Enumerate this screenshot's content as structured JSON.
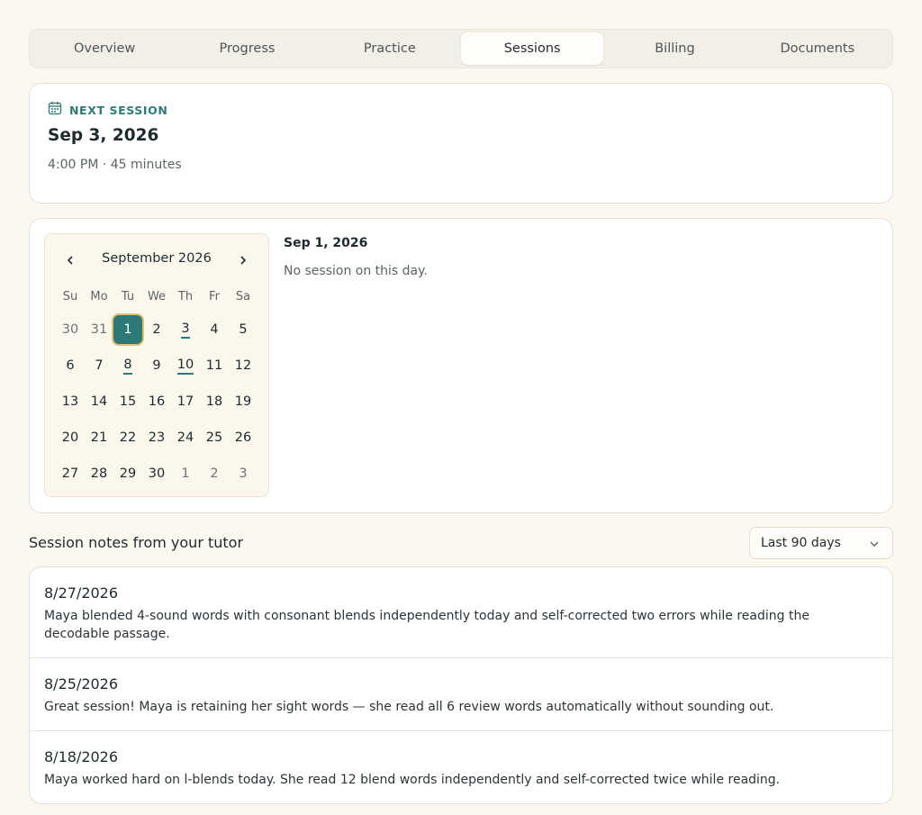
{
  "tabs": [
    "Overview",
    "Progress",
    "Practice",
    "Sessions",
    "Billing",
    "Documents"
  ],
  "active_tab": "Sessions",
  "next_session": {
    "label": "NEXT SESSION",
    "date": "Sep 3, 2026",
    "time": "4:00 PM · 45 minutes"
  },
  "calendar": {
    "month": "September 2026",
    "weekdays": [
      "Su",
      "Mo",
      "Tu",
      "We",
      "Th",
      "Fr",
      "Sa"
    ],
    "days": [
      {
        "d": "30",
        "muted": true
      },
      {
        "d": "31",
        "muted": true
      },
      {
        "d": "1",
        "selected": true
      },
      {
        "d": "2"
      },
      {
        "d": "3",
        "session": true
      },
      {
        "d": "4"
      },
      {
        "d": "5"
      },
      {
        "d": "6"
      },
      {
        "d": "7"
      },
      {
        "d": "8",
        "session": true
      },
      {
        "d": "9"
      },
      {
        "d": "10",
        "session": true
      },
      {
        "d": "11"
      },
      {
        "d": "12"
      },
      {
        "d": "13"
      },
      {
        "d": "14"
      },
      {
        "d": "15"
      },
      {
        "d": "16"
      },
      {
        "d": "17"
      },
      {
        "d": "18"
      },
      {
        "d": "19"
      },
      {
        "d": "20"
      },
      {
        "d": "21"
      },
      {
        "d": "22"
      },
      {
        "d": "23"
      },
      {
        "d": "24"
      },
      {
        "d": "25"
      },
      {
        "d": "26"
      },
      {
        "d": "27"
      },
      {
        "d": "28"
      },
      {
        "d": "29"
      },
      {
        "d": "30"
      },
      {
        "d": "1",
        "muted": true
      },
      {
        "d": "2",
        "muted": true
      },
      {
        "d": "3",
        "muted": true
      }
    ],
    "selected_date": "Sep 1, 2026",
    "empty_message": "No session on this day."
  },
  "notes": {
    "title": "Session notes from your tutor",
    "range": "Last 90 days",
    "items": [
      {
        "date": "8/27/2026",
        "text": "Maya blended 4-sound words with consonant blends independently today and self-corrected two errors while reading the decodable passage."
      },
      {
        "date": "8/25/2026",
        "text": "Great session! Maya is retaining her sight words — she read all 6 review words automatically without sounding out."
      },
      {
        "date": "8/18/2026",
        "text": "Maya worked hard on l-blends today. She read 12 blend words independently and self-corrected twice while reading."
      }
    ]
  },
  "colors": {
    "accent": "#2b7a78",
    "highlight": "#e3c06a",
    "background": "#fcf8f0"
  }
}
